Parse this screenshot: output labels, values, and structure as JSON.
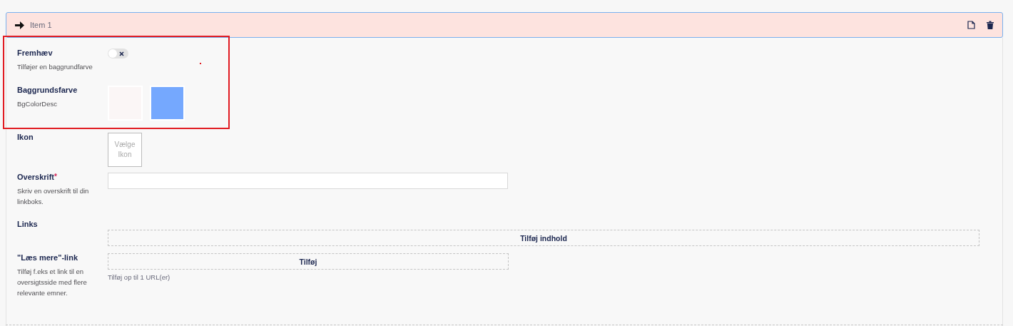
{
  "item": {
    "title": "Item 1"
  },
  "fields": [
    {
      "kind": "toggle",
      "label": "Fremhæv",
      "description": "Tilføjer en baggrundfarve",
      "on": false
    },
    {
      "kind": "colors",
      "label": "Baggrundsfarve",
      "description": "BgColorDesc",
      "swatches": [
        {
          "color": "#fbf6f6"
        },
        {
          "color": "#75a8fe"
        }
      ]
    },
    {
      "kind": "icon",
      "label": "Ikon",
      "button": "Vælge Ikon"
    },
    {
      "kind": "text",
      "label": "Overskrift",
      "required": true,
      "required_mark": "*",
      "description": "Skriv en overskrift til din linkboks."
    },
    {
      "kind": "content",
      "label": "Links",
      "button": "Tilføj indhold"
    },
    {
      "kind": "link",
      "label": "\"Læs mere\"-link",
      "description": "Tilføj f.eks et link til en oversigtsside med flere relevante emner.",
      "button": "Tilføj",
      "hint": "Tilføj op til 1 URL(er)"
    }
  ]
}
